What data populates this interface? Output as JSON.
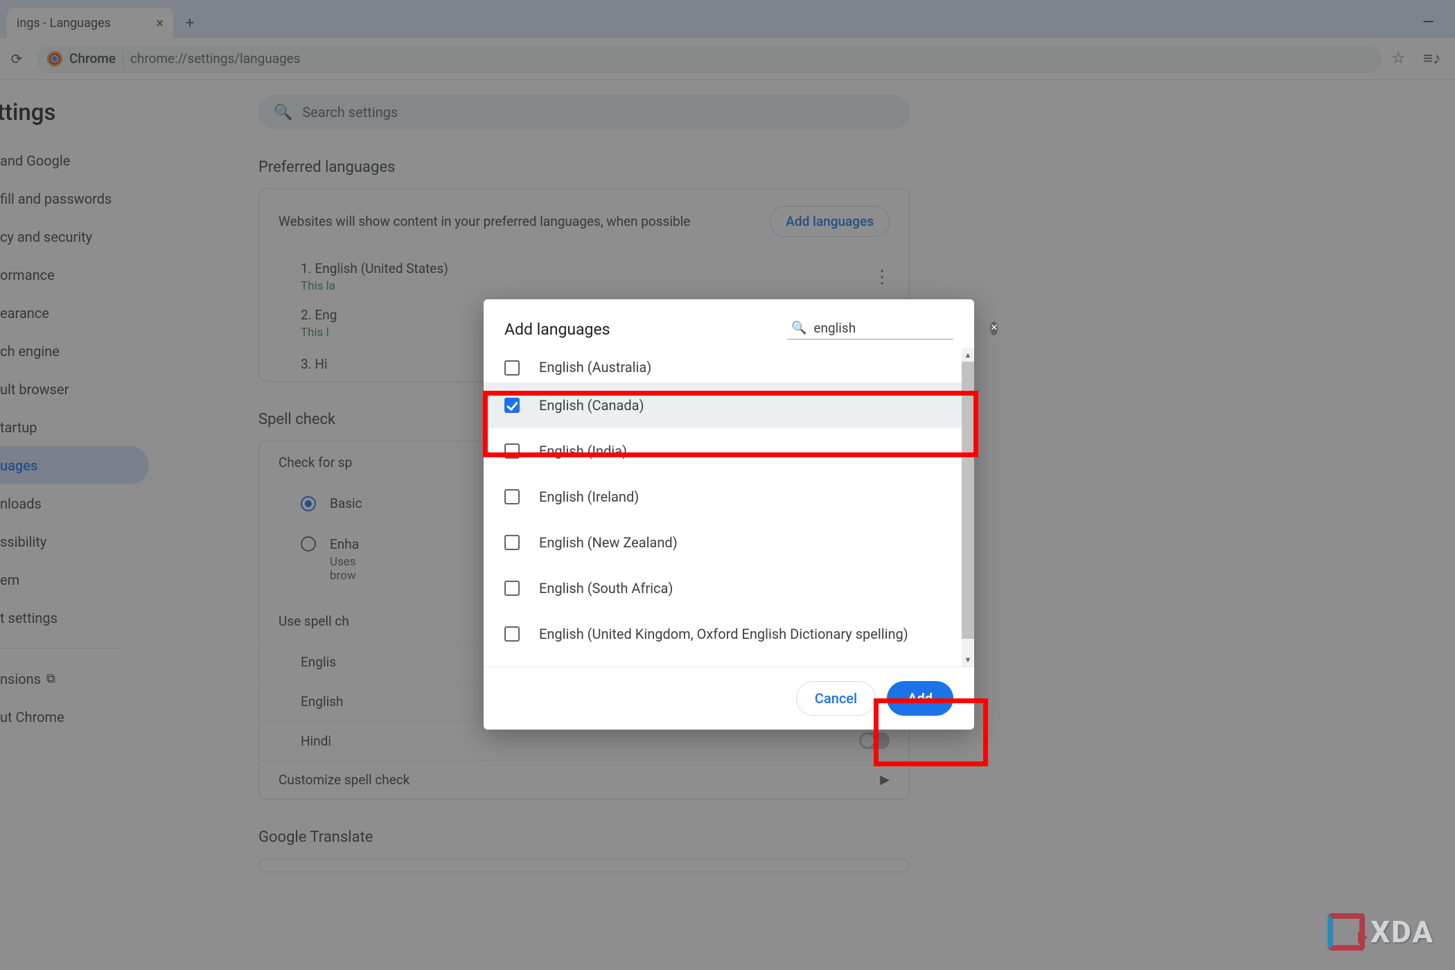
{
  "browser": {
    "tab_title": "ings - Languages",
    "omnibox_prefix": "Chrome",
    "url": "chrome://settings/languages"
  },
  "settings": {
    "page_title": "ttings",
    "search_placeholder": "Search settings",
    "sidebar": {
      "items": [
        " and Google",
        "fill and passwords",
        "cy and security",
        "ormance",
        "earance",
        "ch engine",
        "ult browser",
        "tartup"
      ],
      "active": "uages",
      "items2": [
        "nloads",
        "ssibility",
        "em",
        "t settings"
      ],
      "items3": [
        "nsions",
        "ut Chrome"
      ]
    },
    "preferred": {
      "header": "Preferred languages",
      "hint": "Websites will show content in your preferred languages, when possible",
      "add_btn": "Add languages",
      "langs": [
        {
          "idx": "1.",
          "name": "English (United States)",
          "sub": "This la"
        },
        {
          "idx": "2.",
          "name": "Eng",
          "sub": "This l"
        },
        {
          "idx": "3.",
          "name": "Hi",
          "sub": ""
        }
      ]
    },
    "spell": {
      "header": "Spell check",
      "check_label": "Check for sp",
      "basic": "Basic",
      "enh": "Enha",
      "enh_d1": "Uses",
      "enh_d2": "brow",
      "use_label": "Use spell ch",
      "langs": [
        {
          "name": "Englis",
          "on": true
        },
        {
          "name": "English",
          "on": false
        },
        {
          "name": "Hindi",
          "on": false
        }
      ],
      "customize": "Customize spell check"
    },
    "gt_header": "Google Translate"
  },
  "dialog": {
    "title": "Add languages",
    "search_value": "english",
    "options": [
      {
        "label": "English (Australia)",
        "checked": false
      },
      {
        "label": "English (Canada)",
        "checked": true
      },
      {
        "label": "English (India)",
        "checked": false
      },
      {
        "label": "English (Ireland)",
        "checked": false
      },
      {
        "label": "English (New Zealand)",
        "checked": false
      },
      {
        "label": "English (South Africa)",
        "checked": false
      },
      {
        "label": "English (United Kingdom, Oxford English Dictionary spelling)",
        "checked": false
      }
    ],
    "cancel": "Cancel",
    "add": "Add"
  },
  "watermark": "XDA"
}
